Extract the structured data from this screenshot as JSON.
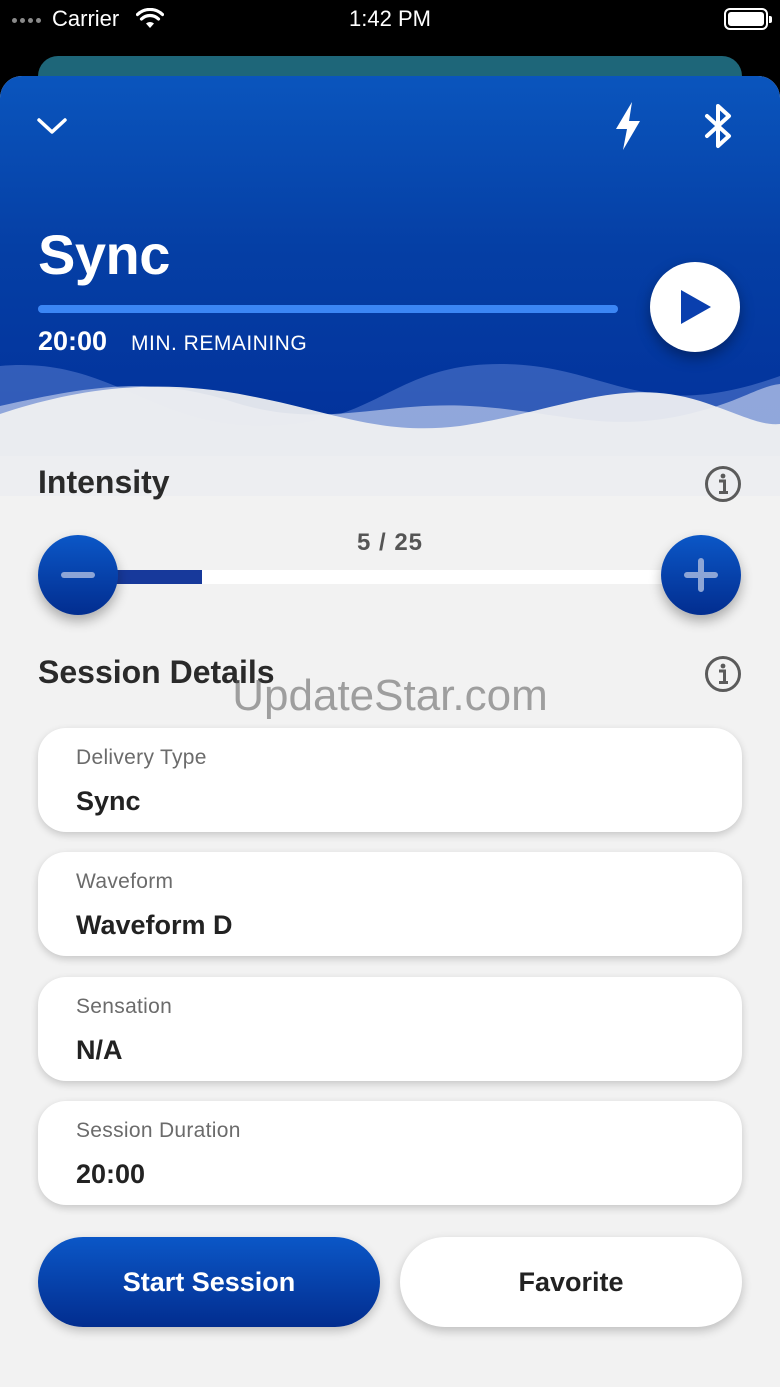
{
  "status_bar": {
    "carrier": "Carrier",
    "time": "1:42 PM"
  },
  "header": {
    "title": "Sync",
    "remaining_time": "20:00",
    "remaining_label": "MIN. REMAINING",
    "progress": 1.0
  },
  "intensity": {
    "title": "Intensity",
    "current": 5,
    "max": 25,
    "display": "5  /  25"
  },
  "session_details": {
    "title": "Session Details",
    "items": [
      {
        "label": "Delivery Type",
        "value": "Sync"
      },
      {
        "label": "Waveform",
        "value": "Waveform D"
      },
      {
        "label": "Sensation",
        "value": "N/A"
      },
      {
        "label": "Session Duration",
        "value": "20:00"
      }
    ]
  },
  "actions": {
    "start_label": "Start Session",
    "favorite_label": "Favorite"
  },
  "watermark": "UpdateStar.com",
  "colors": {
    "primary": "#053fa5",
    "accent": "#3b86f5",
    "background": "#f2f2f2"
  }
}
